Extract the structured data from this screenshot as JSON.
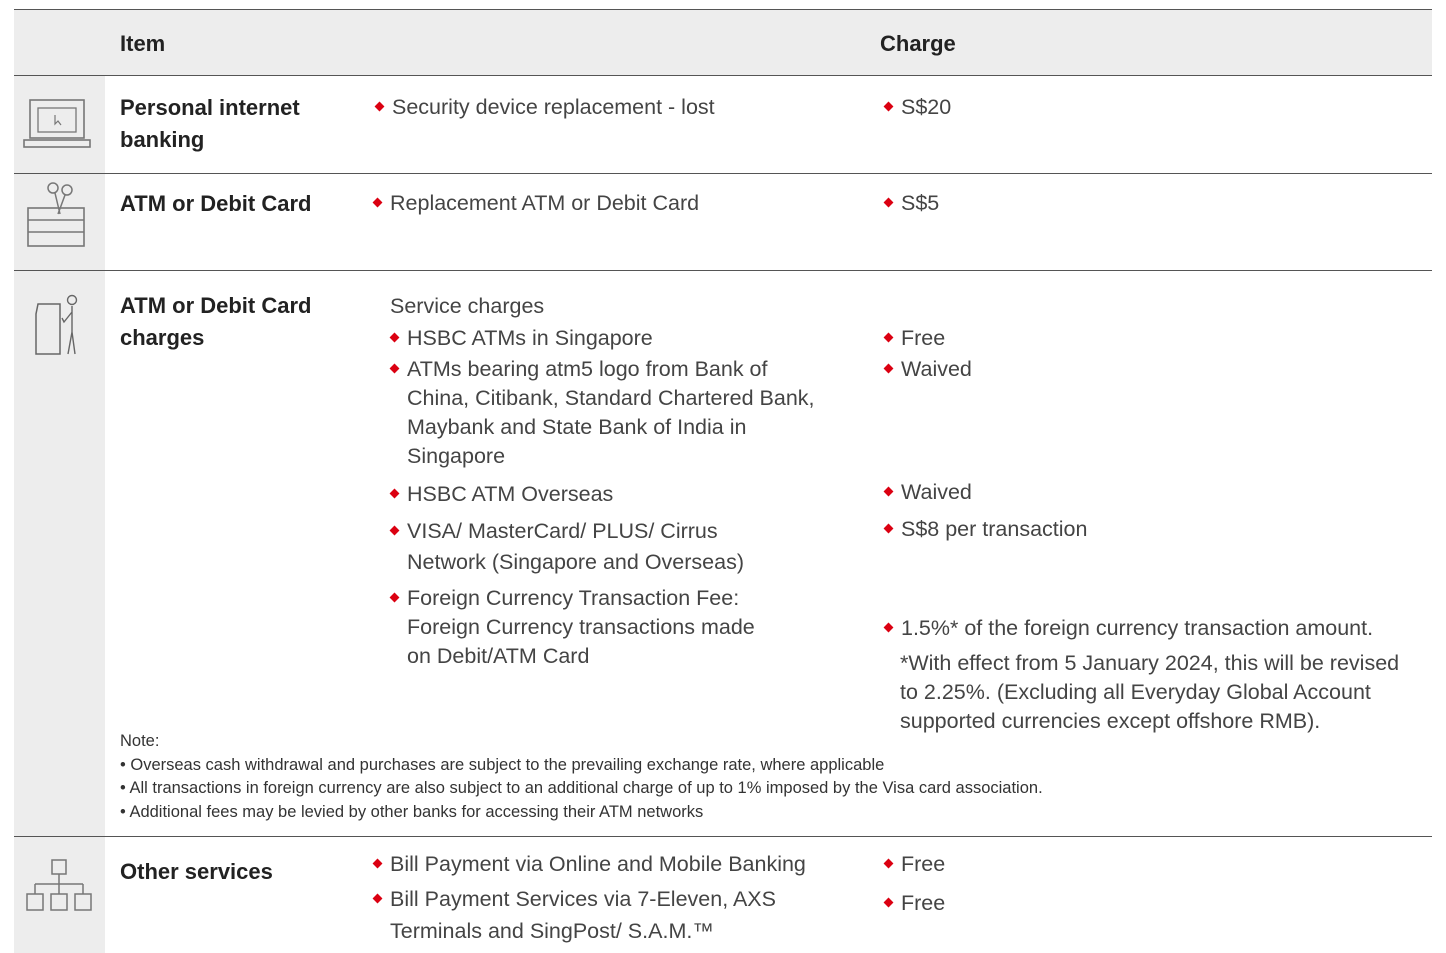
{
  "header": {
    "item": "Item",
    "charge": "Charge"
  },
  "rows": {
    "pib": {
      "category": [
        "Personal internet",
        "banking"
      ],
      "desc": "Security device replacement - lost",
      "charge": "S$20"
    },
    "atm": {
      "category": "ATM or Debit Card",
      "desc": "Replacement ATM or Debit Card",
      "charge": "S$5"
    },
    "charges": {
      "category": [
        "ATM or Debit Card",
        "charges"
      ],
      "heading": "Service charges",
      "items": [
        {
          "desc": [
            "HSBC ATMs in Singapore"
          ],
          "charge": "Free"
        },
        {
          "desc": [
            "ATMs bearing atm5 logo from Bank of",
            "China, Citibank, Standard Chartered Bank,",
            "Maybank and State Bank of India in",
            "Singapore"
          ],
          "charge": "Waived"
        },
        {
          "desc": [
            "HSBC ATM Overseas"
          ],
          "charge": "Waived"
        },
        {
          "desc": [
            "VISA/ MasterCard/ PLUS/ Cirrus",
            "Network (Singapore and Overseas)"
          ],
          "charge": "S$8 per transaction"
        },
        {
          "desc": [
            "Foreign Currency Transaction Fee:",
            "Foreign Currency transactions made",
            "on Debit/ATM Card"
          ],
          "charge": "1.5%* of the foreign currency transaction amount."
        }
      ],
      "footnote": [
        "*With effect from 5 January 2024, this will be revised",
        "to 2.25%. (Excluding all Everyday Global Account",
        "supported currencies except offshore RMB)."
      ],
      "note": {
        "label": "Note:",
        "lines": [
          "• Overseas cash withdrawal and purchases are subject to the prevailing exchange rate, where applicable",
          "• All transactions in foreign currency are also subject to an additional charge of up to 1% imposed by the Visa card association.",
          "• Additional fees may be levied by other banks for accessing their ATM networks"
        ]
      }
    },
    "other": {
      "category": "Other services",
      "items": [
        {
          "desc": [
            "Bill Payment via Online and Mobile Banking"
          ],
          "charge": "Free"
        },
        {
          "desc": [
            "Bill Payment Services via 7-Eleven, AXS",
            "Terminals and SingPost/ S.A.M.™"
          ],
          "charge": "Free"
        }
      ]
    }
  },
  "icons": [
    "laptop-icon",
    "card-scissors-icon",
    "atm-person-icon",
    "network-icon"
  ],
  "colors": {
    "bullet": "#db0011",
    "header_bg": "#ededed"
  }
}
